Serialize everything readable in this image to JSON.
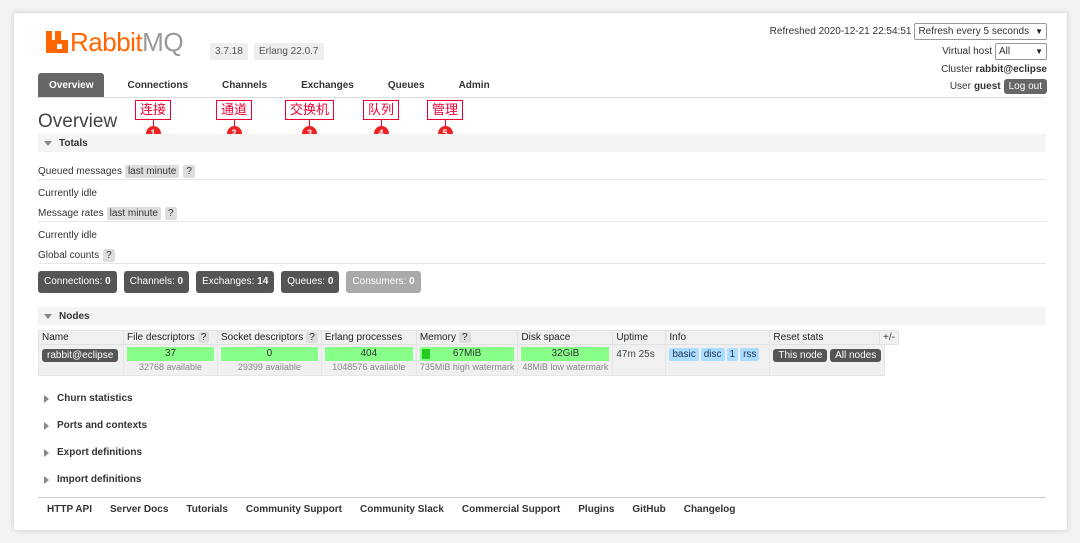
{
  "brand": {
    "logo_main": "Rabbit",
    "logo_suffix": "MQ",
    "version": "3.7.18",
    "erlang": "Erlang 22.0.7"
  },
  "header": {
    "refreshed": "Refreshed 2020-12-21 22:54:51",
    "refresh_select": "Refresh every 5 seconds",
    "vhost_label": "Virtual host",
    "vhost_select": "All",
    "cluster_label": "Cluster",
    "cluster_name": "rabbit@eclipse",
    "user_label": "User",
    "user_name": "guest",
    "logout": "Log out"
  },
  "tabs": [
    "Overview",
    "Connections",
    "Channels",
    "Exchanges",
    "Queues",
    "Admin"
  ],
  "annotations": [
    {
      "text": "连接",
      "num": "1"
    },
    {
      "text": "通道",
      "num": "2"
    },
    {
      "text": "交换机",
      "num": "3"
    },
    {
      "text": "队列",
      "num": "4"
    },
    {
      "text": "管理",
      "num": "5"
    }
  ],
  "page_title": "Overview",
  "totals": {
    "title": "Totals",
    "queued_label": "Queued messages",
    "last_minute": "last minute",
    "help": "?",
    "idle1": "Currently idle",
    "rates_label": "Message rates",
    "idle2": "Currently idle",
    "global_label": "Global counts"
  },
  "counts": [
    {
      "label": "Connections:",
      "value": "0"
    },
    {
      "label": "Channels:",
      "value": "0"
    },
    {
      "label": "Exchanges:",
      "value": "14"
    },
    {
      "label": "Queues:",
      "value": "0"
    },
    {
      "label": "Consumers:",
      "value": "0"
    }
  ],
  "nodes": {
    "title": "Nodes",
    "headers": [
      "Name",
      "File descriptors",
      "Socket descriptors",
      "Erlang processes",
      "Memory",
      "Disk space",
      "Uptime",
      "Info",
      "Reset stats"
    ],
    "plus_minus": "+/-",
    "row": {
      "name": "rabbit@eclipse",
      "fd": "37",
      "fd_sub": "32768 available",
      "sd": "0",
      "sd_sub": "29399 available",
      "ep": "404",
      "ep_sub": "1048576 available",
      "mem": "67MiB",
      "mem_sub": "735MiB high watermark",
      "mem_fraction": 0.09,
      "disk": "32GiB",
      "disk_sub": "48MiB low watermark",
      "uptime": "47m 25s",
      "info": [
        "basic",
        "disc",
        "1",
        "rss"
      ],
      "this_node": "This node",
      "all_nodes": "All nodes"
    }
  },
  "collapsed": [
    "Churn statistics",
    "Ports and contexts",
    "Export definitions",
    "Import definitions"
  ],
  "footer": [
    "HTTP API",
    "Server Docs",
    "Tutorials",
    "Community Support",
    "Community Slack",
    "Commercial Support",
    "Plugins",
    "GitHub",
    "Changelog"
  ]
}
